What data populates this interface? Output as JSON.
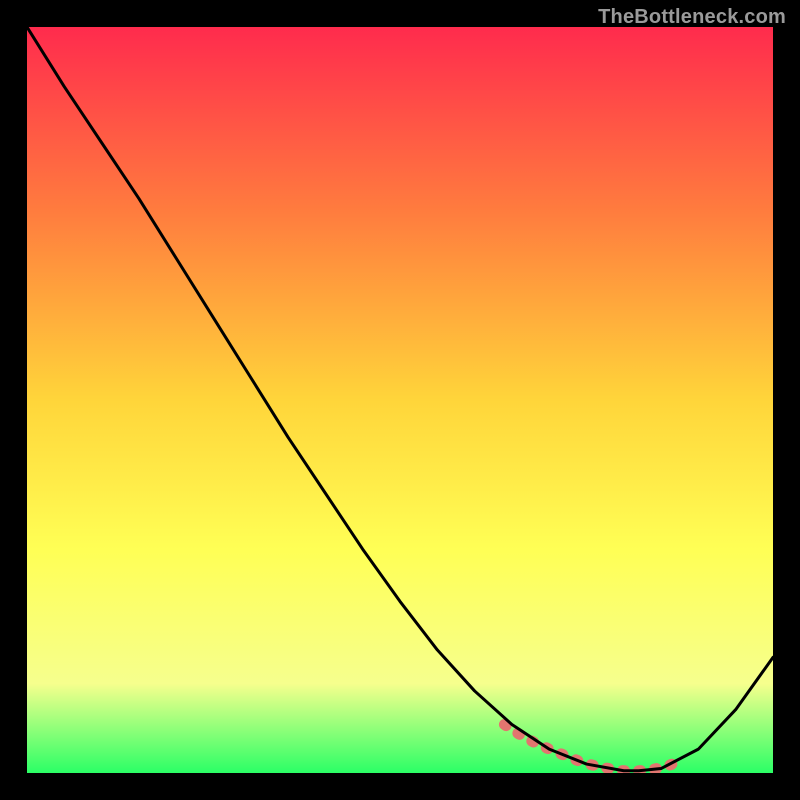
{
  "attribution": "TheBottleneck.com",
  "colors": {
    "bg": "#000000",
    "curve": "#000000",
    "thick_highlight": "#e2756f",
    "grad_top": "#ff2b4d",
    "grad_mid1": "#ff7d3e",
    "grad_mid2": "#ffd53a",
    "grad_mid3": "#ffff55",
    "grad_lemon": "#f6ff8d",
    "grad_green": "#2bff66"
  },
  "chart_data": {
    "type": "line",
    "title": "",
    "xlabel": "",
    "ylabel": "",
    "xlim": [
      0,
      100
    ],
    "ylim": [
      0,
      100
    ],
    "grid": false,
    "legend": false,
    "note": "x and y are percentages of the plot area. y=0 at bottom (green), y=100 at top (red). Curve shows bottleneck score vs. some parameter; minimum (optimal) region highlighted.",
    "series": [
      {
        "name": "curve",
        "x": [
          0,
          5,
          10,
          15,
          20,
          25,
          30,
          35,
          40,
          45,
          50,
          55,
          60,
          65,
          70,
          75,
          80,
          82,
          85,
          90,
          95,
          100
        ],
        "y": [
          100,
          92,
          84.5,
          77,
          69,
          61,
          53,
          45,
          37.5,
          30,
          23,
          16.5,
          11,
          6.5,
          3.2,
          1.2,
          0.3,
          0.3,
          0.6,
          3.2,
          8.5,
          15.5
        ]
      },
      {
        "name": "optimal-range-highlight",
        "x": [
          64,
          66,
          68,
          70,
          72,
          74,
          76,
          78,
          80,
          82,
          84,
          86,
          88
        ],
        "y": [
          6.5,
          5.2,
          4.1,
          3.2,
          2.4,
          1.6,
          1.0,
          0.6,
          0.3,
          0.3,
          0.5,
          1.0,
          1.8
        ]
      }
    ],
    "gradient_stops_percent_from_top": [
      {
        "offset": 0,
        "color": "#ff2b4d"
      },
      {
        "offset": 25,
        "color": "#ff7d3e"
      },
      {
        "offset": 50,
        "color": "#ffd53a"
      },
      {
        "offset": 70,
        "color": "#ffff55"
      },
      {
        "offset": 88,
        "color": "#f6ff8d"
      },
      {
        "offset": 100,
        "color": "#2bff66"
      }
    ]
  }
}
